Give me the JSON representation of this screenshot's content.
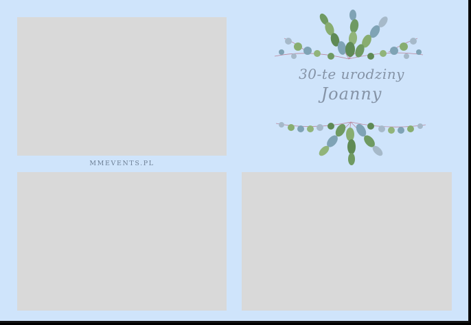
{
  "invitation": {
    "title_line_1": "30-te urodziny",
    "title_line_2": "Joanny"
  },
  "brand": {
    "text": "MMEVENTS.PL"
  },
  "photo_slots": [
    "",
    "",
    ""
  ],
  "colors": {
    "background": "#cfe4fb",
    "photo_placeholder": "#d9d9d9",
    "title_text": "#8593a6",
    "brand_text": "#6d7f95",
    "leaf_green": "#6f9a62",
    "leaf_blue": "#7fa3b5",
    "stem_pink": "#b9859a"
  },
  "icons": {
    "top_decoration": "eucalyptus-wreath-icon",
    "bottom_decoration": "eucalyptus-wreath-icon"
  }
}
